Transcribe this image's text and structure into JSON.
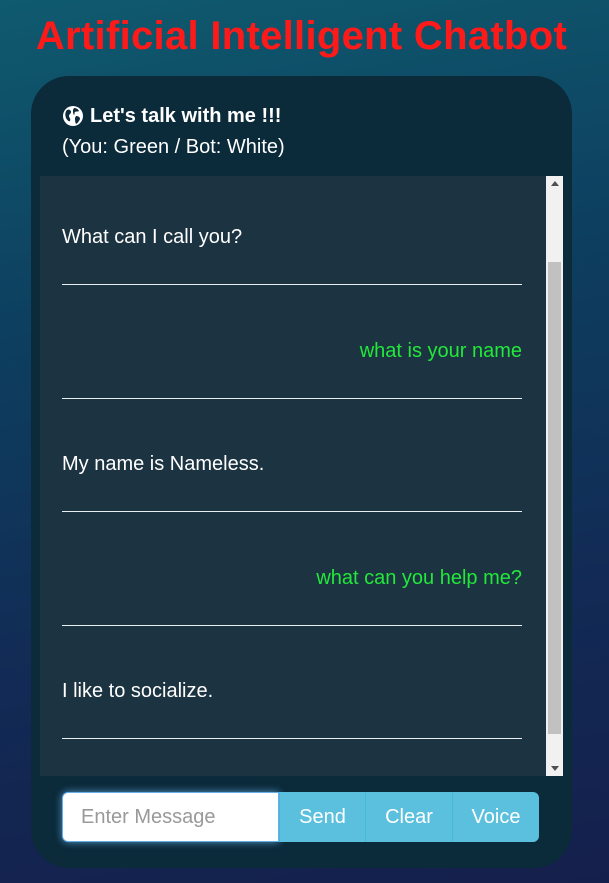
{
  "app": {
    "title": "Artificial Intelligent Chatbot"
  },
  "header": {
    "icon": "globe-icon",
    "title": "Let's talk with me !!!",
    "legend": "(You: Green / Bot: White)"
  },
  "messages": [
    {
      "sender": "bot",
      "text": "What can I call you?"
    },
    {
      "sender": "user",
      "text": "what is your name"
    },
    {
      "sender": "bot",
      "text": "My name is Nameless."
    },
    {
      "sender": "user",
      "text": "what can you help me?"
    },
    {
      "sender": "bot",
      "text": "I like to socialize."
    }
  ],
  "input": {
    "value": "",
    "placeholder": "Enter Message"
  },
  "buttons": {
    "send": "Send",
    "clear": "Clear",
    "voice": "Voice"
  },
  "colors": {
    "title": "#ff1a1a",
    "user_message": "#22e83a",
    "bot_message": "#ffffff",
    "button": "#5bc0de",
    "panel": "#0b2a3a",
    "messages_background": "#1c3341"
  }
}
